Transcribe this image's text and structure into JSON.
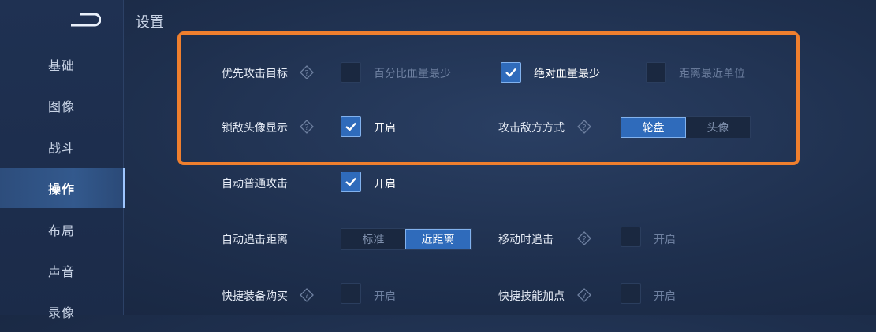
{
  "sidebar": {
    "back_icon": "back-arrow-icon",
    "items": [
      {
        "label": "基础",
        "active": false
      },
      {
        "label": "图像",
        "active": false
      },
      {
        "label": "战斗",
        "active": false
      },
      {
        "label": "操作",
        "active": true
      },
      {
        "label": "布局",
        "active": false
      },
      {
        "label": "声音",
        "active": false
      },
      {
        "label": "录像",
        "active": false
      }
    ]
  },
  "page_title": "设置",
  "colors": {
    "highlight": "#ef7f2e",
    "accent": "#2f6bbb"
  },
  "settings": {
    "priority_target": {
      "label": "优先攻击目标",
      "options": [
        {
          "label": "百分比血量最少",
          "checked": false
        },
        {
          "label": "绝对血量最少",
          "checked": true
        },
        {
          "label": "距离最近单位",
          "checked": false
        }
      ]
    },
    "lock_avatar": {
      "label": "锁敌头像显示",
      "option": "开启",
      "checked": true
    },
    "attack_mode": {
      "label": "攻击敌方方式",
      "options": [
        "轮盘",
        "头像"
      ],
      "selected": "轮盘"
    },
    "auto_normal_attack": {
      "label": "自动普通攻击",
      "option": "开启",
      "checked": true
    },
    "auto_chase_distance": {
      "label": "自动追击距离",
      "options": [
        "标准",
        "近距离"
      ],
      "selected": "近距离"
    },
    "move_chase": {
      "label": "移动时追击",
      "option": "开启",
      "checked": false
    },
    "quick_buy": {
      "label": "快捷装备购买",
      "option": "开启",
      "checked": false
    },
    "quick_skill": {
      "label": "快捷技能加点",
      "option": "开启",
      "checked": false
    }
  }
}
